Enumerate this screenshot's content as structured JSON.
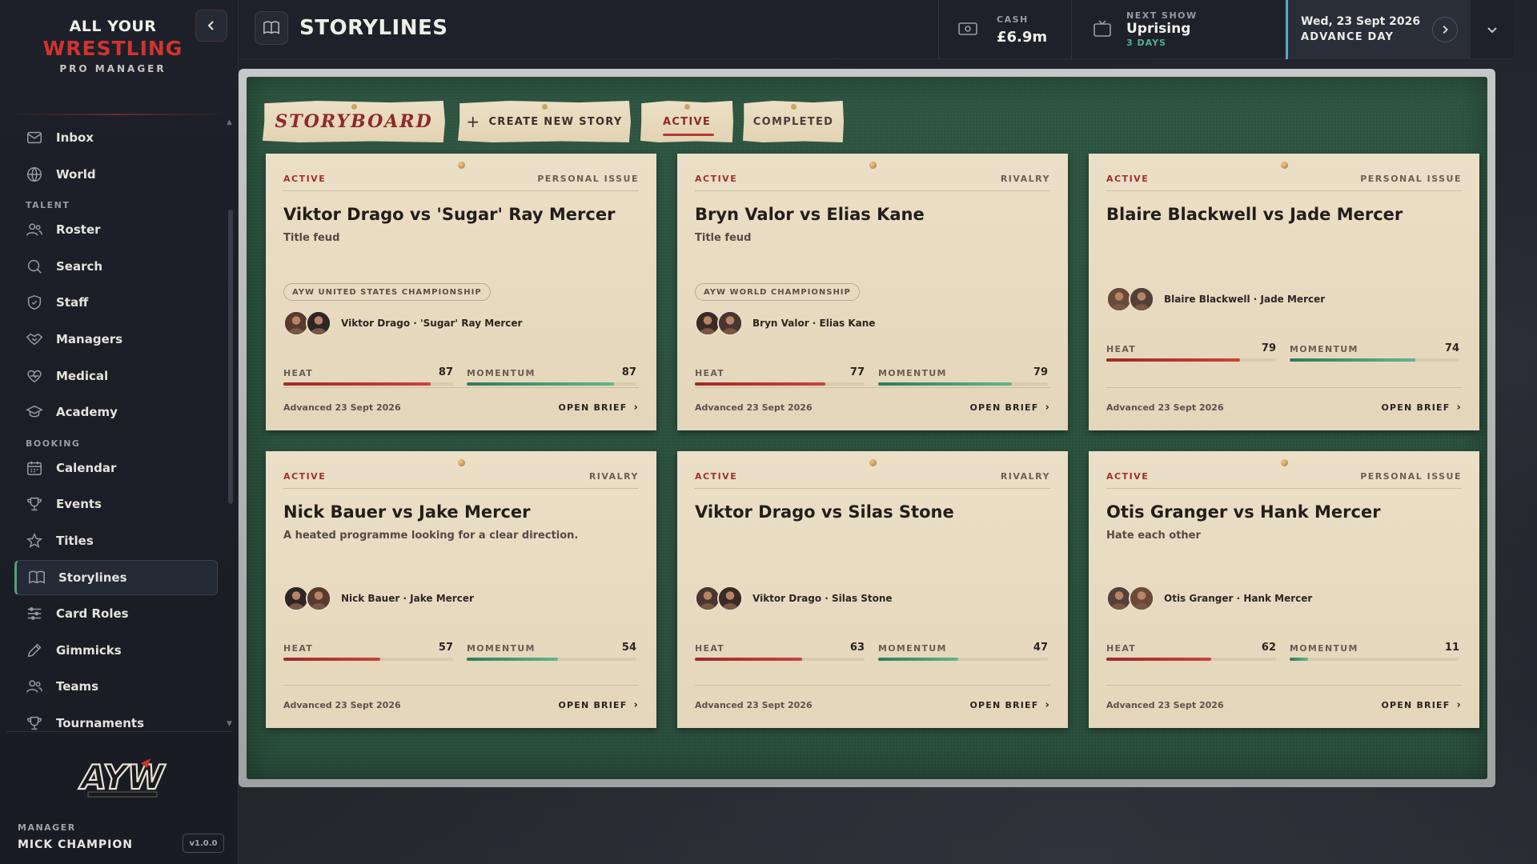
{
  "app": {
    "logo_line1": "ALL YOUR",
    "logo_line2": "WRESTLING",
    "logo_line3": "PRO MANAGER",
    "logo_mark": "AYW",
    "manager_label": "MANAGER",
    "manager_name": "MICK CHAMPION",
    "version": "v1.0.0"
  },
  "sidebar": {
    "items_top": [
      {
        "label": "Inbox",
        "icon": "mail-icon"
      },
      {
        "label": "World",
        "icon": "globe-icon"
      }
    ],
    "group_talent": "TALENT",
    "items_talent": [
      {
        "label": "Roster",
        "icon": "users-icon"
      },
      {
        "label": "Search",
        "icon": "search-icon"
      },
      {
        "label": "Staff",
        "icon": "shield-icon"
      },
      {
        "label": "Managers",
        "icon": "handshake-icon"
      },
      {
        "label": "Medical",
        "icon": "heart-pulse-icon"
      },
      {
        "label": "Academy",
        "icon": "graduation-cap-icon"
      }
    ],
    "group_booking": "BOOKING",
    "items_booking": [
      {
        "label": "Calendar",
        "icon": "calendar-icon"
      },
      {
        "label": "Events",
        "icon": "trophy-icon"
      },
      {
        "label": "Titles",
        "icon": "star-icon"
      },
      {
        "label": "Storylines",
        "icon": "book-icon",
        "active": true
      },
      {
        "label": "Card Roles",
        "icon": "sliders-icon"
      },
      {
        "label": "Gimmicks",
        "icon": "pen-icon"
      },
      {
        "label": "Teams",
        "icon": "users-icon"
      },
      {
        "label": "Tournaments",
        "icon": "trophy-icon"
      }
    ]
  },
  "header": {
    "title": "STORYLINES",
    "cash_label": "CASH",
    "cash_value": "£6.9m",
    "next_show_label": "NEXT SHOW",
    "next_show_name": "Uprising",
    "next_show_days": "3 DAYS",
    "date": "Wed, 23 Sept 2026",
    "advance_label": "ADVANCE DAY"
  },
  "tabs": {
    "storyboard": "STORYBOARD",
    "create": "CREATE NEW STORY",
    "active": "ACTIVE",
    "completed": "COMPLETED"
  },
  "labels": {
    "heat": "HEAT",
    "momentum": "MOMENTUM",
    "open_brief": "OPEN BRIEF"
  },
  "colors": {
    "accent_red": "#a0302b",
    "accent_green": "#4fa27f",
    "board_green": "#2c523f",
    "paper": "#e8dcc4"
  },
  "cards": [
    {
      "status": "ACTIVE",
      "type": "PERSONAL ISSUE",
      "title": "Viktor Drago vs 'Sugar' Ray Mercer",
      "subtitle": "Title feud",
      "championship": "AYW UNITED STATES CHAMPIONSHIP",
      "names": "Viktor Drago · 'Sugar' Ray Mercer",
      "heat": 87,
      "momentum": 87,
      "advanced": "Advanced 23 Sept 2026"
    },
    {
      "status": "ACTIVE",
      "type": "RIVALRY",
      "title": "Bryn Valor vs Elias Kane",
      "subtitle": "Title feud",
      "championship": "AYW WORLD CHAMPIONSHIP",
      "names": "Bryn Valor · Elias Kane",
      "heat": 77,
      "momentum": 79,
      "advanced": "Advanced 23 Sept 2026"
    },
    {
      "status": "ACTIVE",
      "type": "PERSONAL ISSUE",
      "title": "Blaire Blackwell vs Jade Mercer",
      "subtitle": "",
      "championship": "",
      "names": "Blaire Blackwell · Jade Mercer",
      "heat": 79,
      "momentum": 74,
      "advanced": "Advanced 23 Sept 2026"
    },
    {
      "status": "ACTIVE",
      "type": "RIVALRY",
      "title": "Nick Bauer vs Jake Mercer",
      "subtitle": "A heated programme looking for a clear direction.",
      "championship": "",
      "names": "Nick Bauer · Jake Mercer",
      "heat": 57,
      "momentum": 54,
      "advanced": "Advanced 23 Sept 2026"
    },
    {
      "status": "ACTIVE",
      "type": "RIVALRY",
      "title": "Viktor Drago vs Silas Stone",
      "subtitle": "",
      "championship": "",
      "names": "Viktor Drago · Silas Stone",
      "heat": 63,
      "momentum": 47,
      "advanced": "Advanced 23 Sept 2026"
    },
    {
      "status": "ACTIVE",
      "type": "PERSONAL ISSUE",
      "title": "Otis Granger vs Hank Mercer",
      "subtitle": "Hate each other",
      "championship": "",
      "names": "Otis Granger · Hank Mercer",
      "heat": 62,
      "momentum": 11,
      "advanced": "Advanced 23 Sept 2026"
    }
  ]
}
